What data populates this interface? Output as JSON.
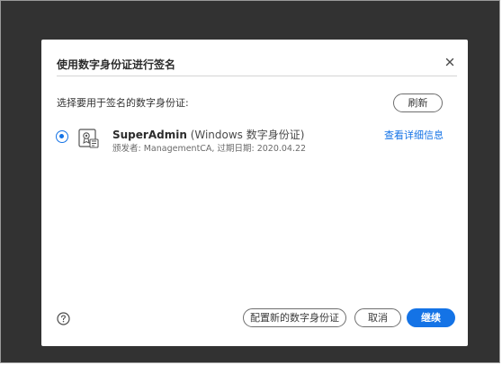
{
  "dialog": {
    "title": "使用数字身份证进行签名",
    "prompt": "选择要用于签名的数字身份证:",
    "refresh_label": "刷新"
  },
  "certificate": {
    "name": "SuperAdmin",
    "type": " (Windows 数字身份证)",
    "details": "颁发者: ManagementCA, 过期日期: 2020.04.22",
    "selected": true,
    "view_details_label": "查看详细信息"
  },
  "footer": {
    "configure_label": "配置新的数字身份证",
    "cancel_label": "取消",
    "continue_label": "继续"
  },
  "colors": {
    "accent": "#1473e6",
    "backdrop": "#323232"
  },
  "icons": {
    "close": "close-icon",
    "certificate": "certificate-icon",
    "radio": "radio-selected",
    "help": "help-icon"
  }
}
